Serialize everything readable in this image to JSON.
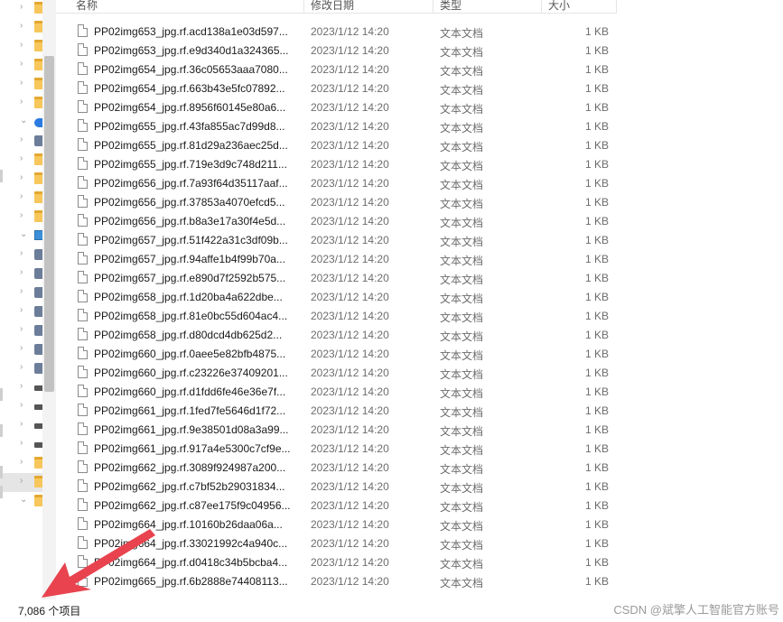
{
  "header": {
    "name": "名称",
    "modified": "修改日期",
    "type": "类型",
    "size": "大小"
  },
  "nav_icons": [
    "folder-icon",
    "folder-icon",
    "folder-icon",
    "folder-icon",
    "folder-icon",
    "folder-icon",
    "cloud-icon",
    "people-icon",
    "folder-icon",
    "folder-icon",
    "folder-icon",
    "folder-icon",
    "pc-icon",
    "cube-icon",
    "video-icon",
    "picture-icon",
    "document-icon",
    "download-icon",
    "music-icon",
    "desktop-icon",
    "drive-icon",
    "drive-icon",
    "drive-icon",
    "network-drive-icon",
    "folder-icon",
    "folder-icon",
    "folder-icon"
  ],
  "files": [
    {
      "name": "PP02img653_jpg.rf.acd138a1e03d597...",
      "date": "2023/1/12 14:20",
      "type": "文本文档",
      "size": "1 KB"
    },
    {
      "name": "PP02img653_jpg.rf.e9d340d1a324365...",
      "date": "2023/1/12 14:20",
      "type": "文本文档",
      "size": "1 KB"
    },
    {
      "name": "PP02img654_jpg.rf.36c05653aaa7080...",
      "date": "2023/1/12 14:20",
      "type": "文本文档",
      "size": "1 KB"
    },
    {
      "name": "PP02img654_jpg.rf.663b43e5fc07892...",
      "date": "2023/1/12 14:20",
      "type": "文本文档",
      "size": "1 KB"
    },
    {
      "name": "PP02img654_jpg.rf.8956f60145e80a6...",
      "date": "2023/1/12 14:20",
      "type": "文本文档",
      "size": "1 KB"
    },
    {
      "name": "PP02img655_jpg.rf.43fa855ac7d99d8...",
      "date": "2023/1/12 14:20",
      "type": "文本文档",
      "size": "1 KB"
    },
    {
      "name": "PP02img655_jpg.rf.81d29a236aec25d...",
      "date": "2023/1/12 14:20",
      "type": "文本文档",
      "size": "1 KB"
    },
    {
      "name": "PP02img655_jpg.rf.719e3d9c748d211...",
      "date": "2023/1/12 14:20",
      "type": "文本文档",
      "size": "1 KB"
    },
    {
      "name": "PP02img656_jpg.rf.7a93f64d35117aaf...",
      "date": "2023/1/12 14:20",
      "type": "文本文档",
      "size": "1 KB"
    },
    {
      "name": "PP02img656_jpg.rf.37853a4070efcd5...",
      "date": "2023/1/12 14:20",
      "type": "文本文档",
      "size": "1 KB"
    },
    {
      "name": "PP02img656_jpg.rf.b8a3e17a30f4e5d...",
      "date": "2023/1/12 14:20",
      "type": "文本文档",
      "size": "1 KB"
    },
    {
      "name": "PP02img657_jpg.rf.51f422a31c3df09b...",
      "date": "2023/1/12 14:20",
      "type": "文本文档",
      "size": "1 KB"
    },
    {
      "name": "PP02img657_jpg.rf.94affe1b4f99b70a...",
      "date": "2023/1/12 14:20",
      "type": "文本文档",
      "size": "1 KB"
    },
    {
      "name": "PP02img657_jpg.rf.e890d7f2592b575...",
      "date": "2023/1/12 14:20",
      "type": "文本文档",
      "size": "1 KB"
    },
    {
      "name": "PP02img658_jpg.rf.1d20ba4a622dbe...",
      "date": "2023/1/12 14:20",
      "type": "文本文档",
      "size": "1 KB"
    },
    {
      "name": "PP02img658_jpg.rf.81e0bc55d604ac4...",
      "date": "2023/1/12 14:20",
      "type": "文本文档",
      "size": "1 KB"
    },
    {
      "name": "PP02img658_jpg.rf.d80dcd4db625d2...",
      "date": "2023/1/12 14:20",
      "type": "文本文档",
      "size": "1 KB"
    },
    {
      "name": "PP02img660_jpg.rf.0aee5e82bfb4875...",
      "date": "2023/1/12 14:20",
      "type": "文本文档",
      "size": "1 KB"
    },
    {
      "name": "PP02img660_jpg.rf.c23226e37409201...",
      "date": "2023/1/12 14:20",
      "type": "文本文档",
      "size": "1 KB"
    },
    {
      "name": "PP02img660_jpg.rf.d1fdd6fe46e36e7f...",
      "date": "2023/1/12 14:20",
      "type": "文本文档",
      "size": "1 KB"
    },
    {
      "name": "PP02img661_jpg.rf.1fed7fe5646d1f72...",
      "date": "2023/1/12 14:20",
      "type": "文本文档",
      "size": "1 KB"
    },
    {
      "name": "PP02img661_jpg.rf.9e38501d08a3a99...",
      "date": "2023/1/12 14:20",
      "type": "文本文档",
      "size": "1 KB"
    },
    {
      "name": "PP02img661_jpg.rf.917a4e5300c7cf9e...",
      "date": "2023/1/12 14:20",
      "type": "文本文档",
      "size": "1 KB"
    },
    {
      "name": "PP02img662_jpg.rf.3089f924987a200...",
      "date": "2023/1/12 14:20",
      "type": "文本文档",
      "size": "1 KB"
    },
    {
      "name": "PP02img662_jpg.rf.c7bf52b29031834...",
      "date": "2023/1/12 14:20",
      "type": "文本文档",
      "size": "1 KB"
    },
    {
      "name": "PP02img662_jpg.rf.c87ee175f9c04956...",
      "date": "2023/1/12 14:20",
      "type": "文本文档",
      "size": "1 KB"
    },
    {
      "name": "PP02img664_jpg.rf.10160b26daa06a...",
      "date": "2023/1/12 14:20",
      "type": "文本文档",
      "size": "1 KB"
    },
    {
      "name": "PP02img664_jpg.rf.33021992c4a940c...",
      "date": "2023/1/12 14:20",
      "type": "文本文档",
      "size": "1 KB"
    },
    {
      "name": "PP02img664_jpg.rf.d0418c34b5bcba4...",
      "date": "2023/1/12 14:20",
      "type": "文本文档",
      "size": "1 KB"
    },
    {
      "name": "PP02img665_jpg.rf.6b2888e74408113...",
      "date": "2023/1/12 14:20",
      "type": "文本文档",
      "size": "1 KB"
    }
  ],
  "status": {
    "item_count": "7,086 个项目"
  },
  "watermark": "CSDN @斌擎人工智能官方账号",
  "colors": {
    "arrow": "#e8434f",
    "folder": "#f7c75b",
    "cloud": "#2a7ae2"
  }
}
